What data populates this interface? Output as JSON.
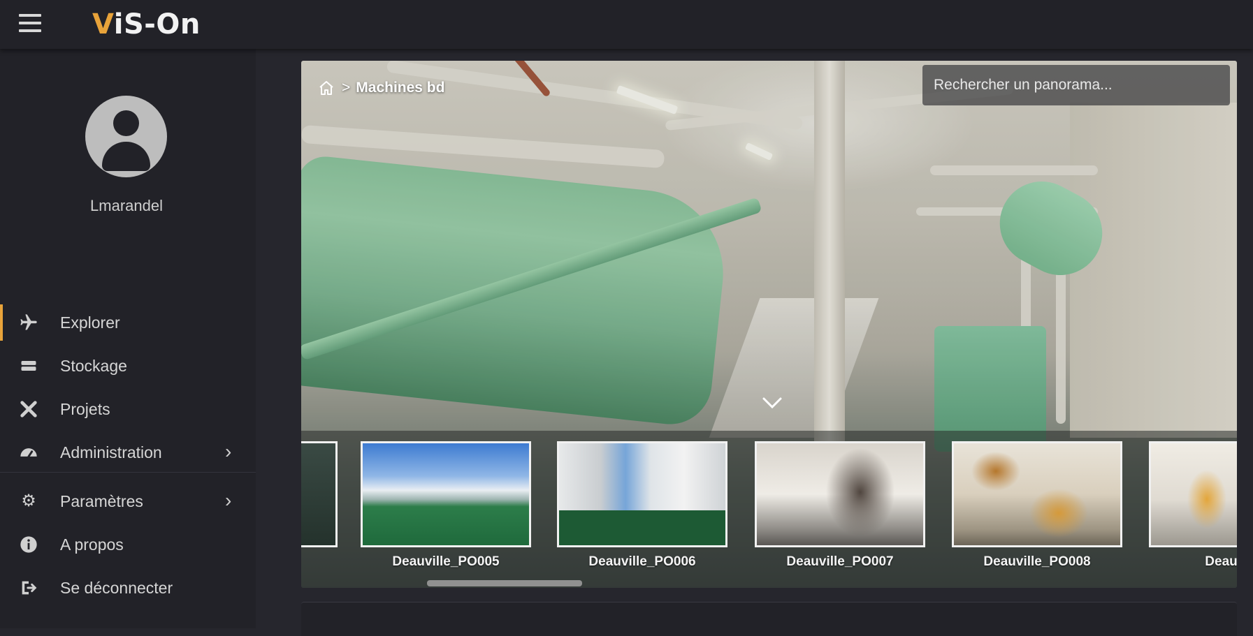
{
  "app": {
    "logo_prefix": "V",
    "logo_rest": "iS-On",
    "accent_color": "#e8a33a"
  },
  "user": {
    "name": "Lmarandel"
  },
  "nav": {
    "items": [
      {
        "label": "Explorer",
        "icon": "plane-icon",
        "active": true
      },
      {
        "label": "Stockage",
        "icon": "storage-icon"
      },
      {
        "label": "Projets",
        "icon": "tools-icon"
      },
      {
        "label": "Administration",
        "icon": "dashboard-icon",
        "has_submenu": true
      },
      {
        "label": "Paramètres",
        "icon": "gear-icon",
        "has_submenu": true
      },
      {
        "label": "A propos",
        "icon": "info-icon"
      },
      {
        "label": "Se déconnecter",
        "icon": "logout-icon"
      }
    ]
  },
  "breadcrumb": {
    "separator": ">",
    "current": "Machines bd"
  },
  "search": {
    "placeholder": "Rechercher un panorama..."
  },
  "thumbnails": [
    {
      "label": "Deauville_PO005"
    },
    {
      "label": "Deauville_PO006"
    },
    {
      "label": "Deauville_PO007"
    },
    {
      "label": "Deauville_PO008"
    },
    {
      "label": "Deauville"
    }
  ]
}
